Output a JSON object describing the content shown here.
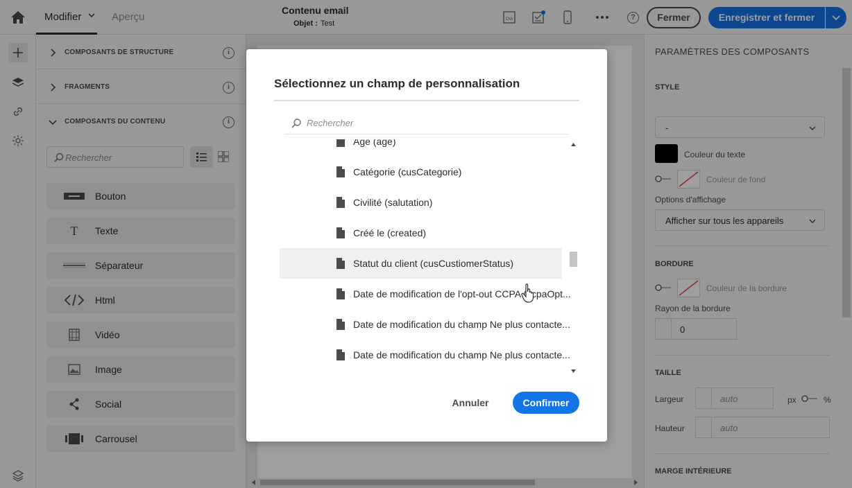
{
  "topbar": {
    "tab_edit": "Modifier",
    "tab_preview": "Aperçu",
    "title": "Contenu email",
    "subject_label": "Objet :",
    "subject_value": "Test",
    "close_label": "Fermer",
    "save_close_label": "Enregistrer et fermer",
    "help_label": "?"
  },
  "left_panel": {
    "sections": [
      {
        "title": "COMPOSANTS DE STRUCTURE"
      },
      {
        "title": "FRAGMENTS"
      },
      {
        "title": "COMPOSANTS DU CONTENU"
      }
    ],
    "info_glyph": "i",
    "search_placeholder": "Rechercher",
    "components": [
      {
        "label": "Bouton",
        "icon": "button-icon"
      },
      {
        "label": "Texte",
        "icon": "text-icon"
      },
      {
        "label": "Séparateur",
        "icon": "separator-icon"
      },
      {
        "label": "Html",
        "icon": "code-icon"
      },
      {
        "label": "Vidéo",
        "icon": "video-icon"
      },
      {
        "label": "Image",
        "icon": "image-icon"
      },
      {
        "label": "Social",
        "icon": "share-icon"
      },
      {
        "label": "Carrousel",
        "icon": "carousel-icon"
      }
    ]
  },
  "right_panel": {
    "title": "PARAMÈTRES DES COMPOSANTS",
    "style_section": "STYLE",
    "style_select_value": "-",
    "text_color_label": "Couleur du texte",
    "text_color": "#000000",
    "bg_color_label": "Couleur de fond",
    "display_options_label": "Options d'affichage",
    "display_options_value": "Afficher sur tous les appareils",
    "border_section": "BORDURE",
    "border_color_label": "Couleur de la bordure",
    "border_radius_label": "Rayon de la bordure",
    "border_radius_value": "0",
    "size_section": "TAILLE",
    "width_label": "Largeur",
    "width_placeholder": "auto",
    "unit_px": "px",
    "unit_percent": "%",
    "height_label": "Hauteur",
    "height_placeholder": "auto",
    "padding_section": "MARGE INTÉRIEURE"
  },
  "modal": {
    "title": "Sélectionnez un champ de personnalisation",
    "search_placeholder": "Rechercher",
    "items": [
      {
        "label": "Age (age)"
      },
      {
        "label": "Catégorie (cusCategorie)"
      },
      {
        "label": "Civilité (salutation)"
      },
      {
        "label": "Créé le (created)"
      },
      {
        "label": "Statut du client (cusCustiomerStatus)"
      },
      {
        "label": "Date de modification de l'opt-out CCPA (ccpaOpt..."
      },
      {
        "label": "Date de modification du champ Ne plus contacte..."
      },
      {
        "label": "Date de modification du champ Ne plus contacte..."
      }
    ],
    "hovered_index": 4,
    "cancel_label": "Annuler",
    "confirm_label": "Confirmer"
  },
  "colors": {
    "accent": "#1473e6",
    "overlay": "rgba(0,0,0,0.38)"
  }
}
